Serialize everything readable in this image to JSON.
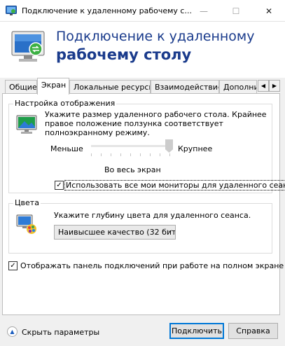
{
  "window": {
    "title": "Подключение к удаленному рабочему с...",
    "minimize_glyph": "—",
    "maximize_glyph": "☐",
    "close_glyph": "✕"
  },
  "banner": {
    "line1": "Подключение к удаленному",
    "line2": "рабочему столу"
  },
  "tabs": [
    {
      "label": "Общие",
      "active": false
    },
    {
      "label": "Экран",
      "active": true
    },
    {
      "label": "Локальные ресурсы",
      "active": false
    },
    {
      "label": "Взаимодействие",
      "active": false
    },
    {
      "label": "Дополни",
      "active": false
    }
  ],
  "tab_scroll": {
    "left": "◀",
    "right": "▶"
  },
  "display_settings": {
    "group_label": "Настройка отображения",
    "description": "Укажите размер удаленного рабочего стола. Крайнее правое положение ползунка соответствует полноэкранному режиму.",
    "slider_min_label": "Меньше",
    "slider_max_label": "Крупнее",
    "slider_value_label": "Во весь экран",
    "slider_value": 1.0,
    "use_all_monitors_label": "Использовать все мои мониторы для удаленного сеанса",
    "use_all_monitors_checked": true
  },
  "colors": {
    "group_label": "Цвета",
    "description": "Укажите глубину цвета для удаленного сеанса.",
    "selected_option": "Наивысшее качество (32 бит"
  },
  "connection_bar": {
    "label": "Отображать панель подключений при работе на полном экране",
    "checked": true
  },
  "footer": {
    "toggle_label": "Скрыть параметры",
    "toggle_glyph": "▲",
    "connect_button": "Подключить",
    "help_button": "Справка"
  },
  "theme": {
    "accent": "#0078d7",
    "banner_text": "#1a3b8c"
  }
}
